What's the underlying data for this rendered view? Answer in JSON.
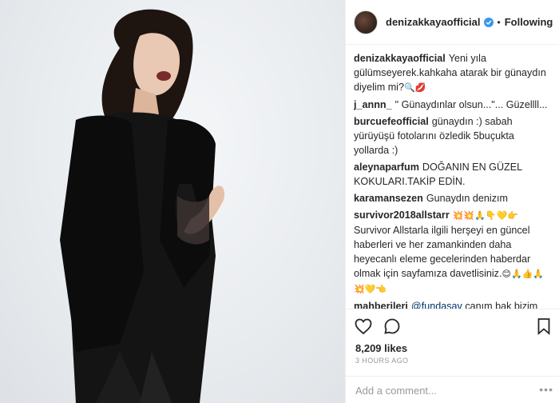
{
  "post": {
    "author": "denizakkayaofficial",
    "following_label": "Following",
    "separator": "•",
    "caption": "Yeni yıla gülümseyerek.kahkaha atarak bir günaydın diyelim mi?",
    "caption_emoji": "🔍💋",
    "likes": "8,209 likes",
    "time": "3 HOURS AGO",
    "add_comment_placeholder": "Add a comment...",
    "more_label": "•••"
  },
  "comments": [
    {
      "user": "j_annn_",
      "text": "\" Günaydınlar olsun...\"... Güzellll..."
    },
    {
      "user": "burcuefeofficial",
      "text": "günaydın :) sabah yürüyüşü fotolarını özledik 5buçukta yollarda :)"
    },
    {
      "user": "aleynaparfum",
      "text": "DOĞANIN EN GÜZEL KOKULARI.TAKİP EDİN."
    },
    {
      "user": "karamansezen",
      "text": "Gunaydın denizım"
    },
    {
      "user": "survivor2018allstarr",
      "text": "Survivor Allstarla ilgili herşeyi en güncel haberleri ve her zamankinden daha heyecanlı eleme gecelerinden haberdar olmak için sayfamıza davetlisiniz.",
      "emoji_before": "💥💥🙏👇💛👉",
      "emoji_after": "😊🙏👍🙏💥💛👈"
    },
    {
      "user": "mahberileri",
      "mention": "@fundasav",
      "text": "canım bak bizim bluzu kim giymiş",
      "emoji_after": "😂"
    }
  ],
  "icons": {
    "like": "heart-icon",
    "comment": "comment-bubble-icon",
    "save": "bookmark-icon",
    "verified": "verified-badge-icon"
  },
  "colors": {
    "text": "#262626",
    "muted": "#999999",
    "verified": "#3897f0",
    "mention": "#003569"
  }
}
